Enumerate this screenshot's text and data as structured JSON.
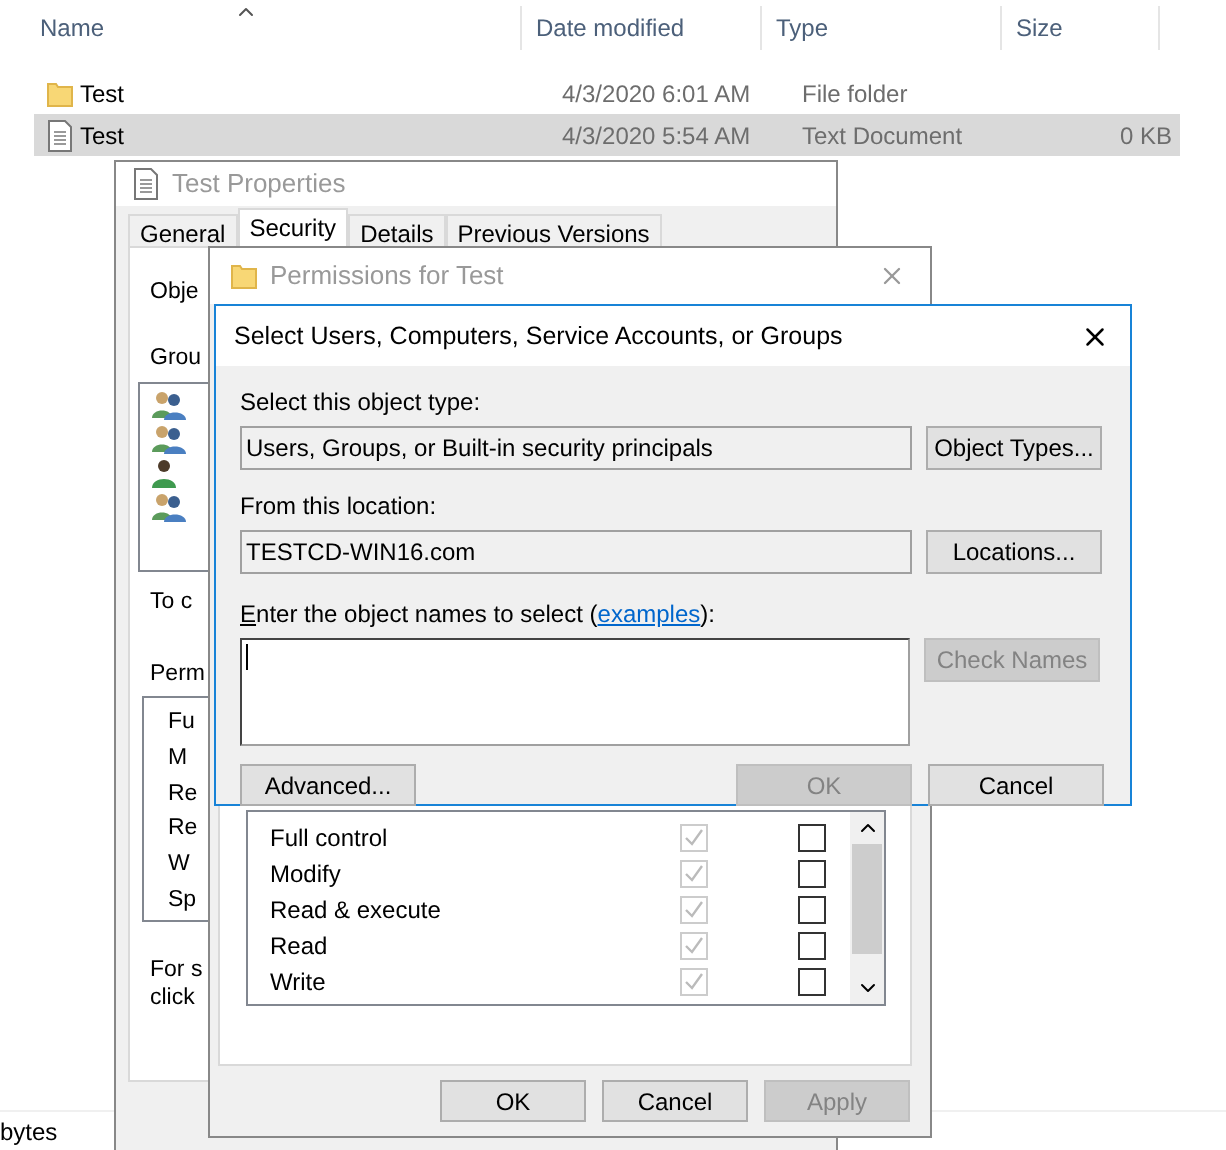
{
  "explorer": {
    "columns": [
      {
        "label": "Name",
        "sorted": true
      },
      {
        "label": "Date modified",
        "sorted": false
      },
      {
        "label": "Type",
        "sorted": false
      },
      {
        "label": "Size",
        "sorted": false
      }
    ],
    "rows": [
      {
        "kind": "folder",
        "name": "Test",
        "date": "4/3/2020 6:01 AM",
        "type": "File folder",
        "selected": false
      },
      {
        "kind": "document",
        "name": "Test",
        "date": "4/3/2020 5:54 AM",
        "type": "Text Document",
        "size": "0 KB",
        "selected": true
      }
    ],
    "status_bar": "bytes"
  },
  "properties_window": {
    "title": "Test Properties",
    "tabs": [
      {
        "label": "General",
        "selected": false
      },
      {
        "label": "Security",
        "selected": true
      },
      {
        "label": "Details",
        "selected": false
      },
      {
        "label": "Previous Versions",
        "selected": false
      }
    ],
    "object_label": "Obje",
    "groups_label": "Grou",
    "groups": [
      {
        "kind": "group"
      },
      {
        "kind": "group"
      },
      {
        "kind": "user"
      },
      {
        "kind": "group"
      }
    ],
    "change_hint": "To c",
    "permissions_label": "Perm",
    "permissions": [
      "Fu",
      "M",
      "Re",
      "Re",
      "W",
      "Sp"
    ],
    "advanced_hint": [
      "For s",
      "click"
    ]
  },
  "permissions_window": {
    "title": "Permissions for Test",
    "permissions": [
      {
        "name": "Full control",
        "allow": true,
        "allow_disabled": true,
        "deny": false
      },
      {
        "name": "Modify",
        "allow": true,
        "allow_disabled": true,
        "deny": false
      },
      {
        "name": "Read & execute",
        "allow": true,
        "allow_disabled": true,
        "deny": false
      },
      {
        "name": "Read",
        "allow": true,
        "allow_disabled": true,
        "deny": false
      },
      {
        "name": "Write",
        "allow": true,
        "allow_disabled": true,
        "deny": false
      }
    ],
    "buttons": [
      {
        "label": "OK",
        "disabled": false
      },
      {
        "label": "Cancel",
        "disabled": false
      },
      {
        "label": "Apply",
        "disabled": true
      }
    ]
  },
  "select_dialog": {
    "title": "Select Users, Computers, Service Accounts, or Groups",
    "object_type_label": "Select this object type:",
    "object_type": "Users, Groups, or Built-in security principals",
    "object_types_button": "Object Types...",
    "location_label": "From this location:",
    "location": "TESTCD-WIN16.com",
    "locations_button": "Locations...",
    "names_label": {
      "prefix": "Enter the object names to select (",
      "link": "examples",
      "suffix": "):"
    },
    "check_names_button": {
      "label": "Check Names",
      "disabled": true
    },
    "buttons": [
      {
        "label": "Advanced...",
        "disabled": false
      },
      {
        "label": "OK",
        "disabled": true
      },
      {
        "label": "Cancel",
        "disabled": false
      }
    ]
  }
}
